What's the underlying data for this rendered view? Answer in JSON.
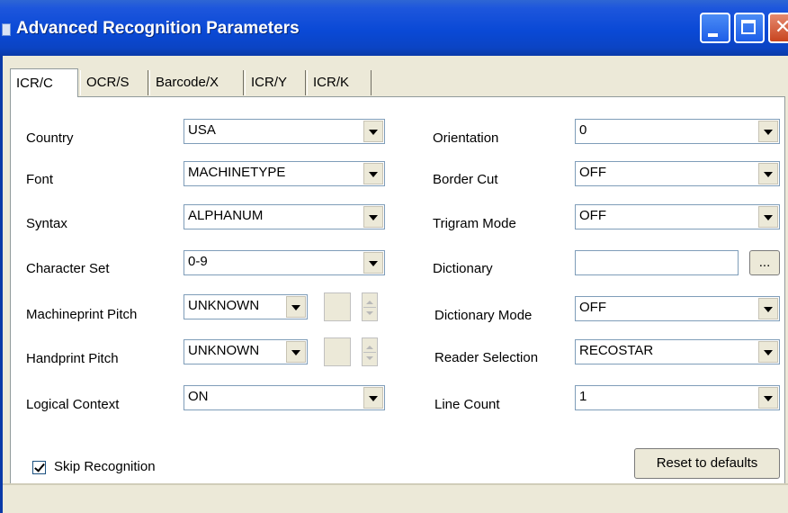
{
  "window": {
    "title": "Advanced Recognition Parameters"
  },
  "tabs": [
    {
      "label": "ICR/C",
      "active": true
    },
    {
      "label": "OCR/S",
      "active": false
    },
    {
      "label": "Barcode/X",
      "active": false
    },
    {
      "label": "ICR/Y",
      "active": false
    },
    {
      "label": "ICR/K",
      "active": false
    }
  ],
  "left": {
    "country": {
      "label": "Country",
      "value": "USA"
    },
    "font": {
      "label": "Font",
      "value": "MACHINETYPE"
    },
    "syntax": {
      "label": "Syntax",
      "value": "ALPHANUM"
    },
    "charset": {
      "label": "Character Set",
      "value": "0-9"
    },
    "machine_pitch": {
      "label": "Machineprint Pitch",
      "value": "UNKNOWN"
    },
    "hand_pitch": {
      "label": "Handprint Pitch",
      "value": "UNKNOWN"
    },
    "logical_context": {
      "label": "Logical Context",
      "value": "ON"
    }
  },
  "right": {
    "orientation": {
      "label": "Orientation",
      "value": "0"
    },
    "border_cut": {
      "label": "Border Cut",
      "value": "OFF"
    },
    "trigram": {
      "label": "Trigram Mode",
      "value": "OFF"
    },
    "dictionary": {
      "label": "Dictionary",
      "value": "",
      "browse_label": "..."
    },
    "dictionary_mode": {
      "label": "Dictionary Mode",
      "value": "OFF"
    },
    "reader_selection": {
      "label": "Reader Selection",
      "value": "RECOSTAR"
    },
    "line_count": {
      "label": "Line Count",
      "value": "1"
    }
  },
  "skip_recognition": {
    "label": "Skip Recognition",
    "checked": true
  },
  "reset_button": {
    "label": "Reset to defaults"
  },
  "colors": {
    "titlebar": "#0a49d6",
    "face": "#ece9d8",
    "panel": "#ffffff",
    "close": "#c8441f"
  }
}
